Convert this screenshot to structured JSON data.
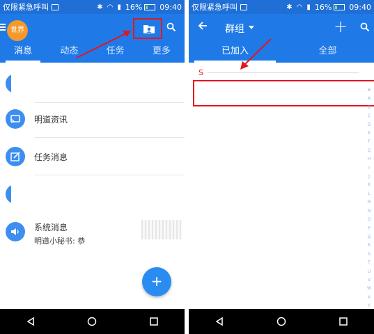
{
  "colors": {
    "primary": "#1f7ae8",
    "status_bar": "#1f6fd6",
    "accent_orange": "#f39a2b",
    "annotation_red": "#e3161e",
    "fab_blue": "#2a8cf0",
    "index_blue": "#8fb6e6"
  },
  "status_bar": {
    "carrier": "仅限紧急呼叫",
    "battery": "16%",
    "time": "09:40"
  },
  "left": {
    "avatar_text": "世界",
    "tabs": [
      {
        "label": "消息",
        "active": true
      },
      {
        "label": "动态",
        "active": false
      },
      {
        "label": "任务",
        "active": false
      },
      {
        "label": "更多",
        "active": false
      }
    ],
    "messages": [
      {
        "title": "明道资讯",
        "icon": "cast-icon"
      },
      {
        "title": "任务消息",
        "icon": "task-edit-icon"
      },
      {
        "title": "系统消息",
        "subtitle": "明道小秘书: 恭",
        "icon": "speaker-icon"
      }
    ],
    "fab_label": "+"
  },
  "right": {
    "title": "群组",
    "tabs": [
      {
        "label": "已加入",
        "active": true
      },
      {
        "label": "全部",
        "active": false
      }
    ],
    "section_letter": "S",
    "index_letters": [
      "#",
      "A",
      "B",
      "C",
      "D",
      "E",
      "F",
      "G",
      "H",
      "I",
      "J",
      "K",
      "L",
      "M",
      "N",
      "O",
      "P",
      "Q",
      "R",
      "S",
      "T",
      "U",
      "V",
      "W",
      "X",
      "Y",
      "Z"
    ]
  },
  "icons": {
    "menu": "hamburger-icon",
    "contacts": "contacts-folder-icon",
    "search": "search-icon",
    "back": "arrow-back-icon",
    "add": "plus-icon",
    "nav_back": "triangle-back-icon",
    "nav_home": "circle-home-icon",
    "nav_recent": "square-recent-icon"
  }
}
